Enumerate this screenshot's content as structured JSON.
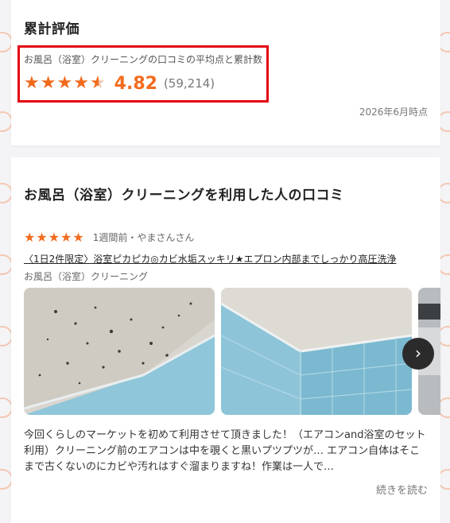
{
  "summary": {
    "title": "累計評価",
    "subtitle": "お風呂（浴室）クリーニングの口コミの平均点と累計数",
    "average": "4.82",
    "count": "(59,214)",
    "as_of": "2026年6月時点",
    "rating_value": 4.82,
    "star_color": "#f26b1d",
    "highlight_color": "#e30613"
  },
  "reviews": {
    "title": "お風呂（浴室）クリーニングを利用した人の口コミ",
    "items": [
      {
        "rating": 5,
        "meta": "1週間前・やまさんさん",
        "headline": "〈1日2件限定〉浴室ピカピカ◎カビ水垢スッキリ★エプロン内部までしっかり高圧洗浄",
        "category": "お風呂（浴室）クリーニング",
        "body": "今回くらしのマーケットを初めて利用させて頂きました！（エアコンand浴室のセット利用）クリーニング前のエアコンは中を覗くと黒いプツプツが… エアコン自体はそこまで古くないのにカビや汚れはすぐ溜まりますね！作業は一人で…",
        "read_more": "続きを読む"
      }
    ]
  },
  "icons": {
    "star": "star-icon",
    "next": "chevron-right-icon"
  }
}
